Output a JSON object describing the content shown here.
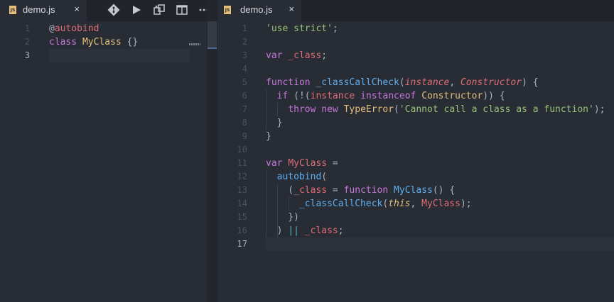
{
  "colors": {
    "background": "#282c34",
    "tab_bar": "#21252b",
    "keyword": "#c678dd",
    "class_name": "#e5c07b",
    "function_name": "#61afef",
    "string": "#98c379",
    "parameter": "#e06c75",
    "js_icon": "#e5c07b"
  },
  "left_editor": {
    "tab": {
      "title": "demo.js",
      "icon": "js-file-icon",
      "close": "×"
    },
    "toolbar": [
      {
        "name": "git-icon",
        "label": "Git"
      },
      {
        "name": "play-icon",
        "label": "Run"
      },
      {
        "name": "compare-icon",
        "label": "Compare"
      },
      {
        "name": "split-icon",
        "label": "Split editor"
      },
      {
        "name": "more-icon",
        "label": "More actions"
      }
    ],
    "line_numbers": [
      "1",
      "2",
      "3"
    ],
    "lines": [
      [
        {
          "t": "@",
          "c": "plain"
        },
        {
          "t": "autobind",
          "c": "var"
        }
      ],
      [
        {
          "t": "class",
          "c": "kw"
        },
        {
          "t": " ",
          "c": "plain"
        },
        {
          "t": "MyClass",
          "c": "cls"
        },
        {
          "t": " {}",
          "c": "plain"
        }
      ],
      []
    ]
  },
  "right_editor": {
    "tab": {
      "title": "demo.js",
      "icon": "js-file-icon",
      "close": "×"
    },
    "line_numbers": [
      "1",
      "2",
      "3",
      "4",
      "5",
      "6",
      "7",
      "8",
      "9",
      "10",
      "11",
      "12",
      "13",
      "14",
      "15",
      "16",
      "17"
    ],
    "lines": [
      [
        {
          "t": "'use strict'",
          "c": "str"
        },
        {
          "t": ";",
          "c": "plain"
        }
      ],
      [],
      [
        {
          "t": "var",
          "c": "kw"
        },
        {
          "t": " ",
          "c": "plain"
        },
        {
          "t": "_class",
          "c": "var"
        },
        {
          "t": ";",
          "c": "plain"
        }
      ],
      [],
      [
        {
          "t": "function",
          "c": "kw"
        },
        {
          "t": " ",
          "c": "plain"
        },
        {
          "t": "_classCallCheck",
          "c": "fn"
        },
        {
          "t": "(",
          "c": "plain"
        },
        {
          "t": "instance",
          "c": "par"
        },
        {
          "t": ", ",
          "c": "plain"
        },
        {
          "t": "Constructor",
          "c": "par"
        },
        {
          "t": ") {",
          "c": "plain"
        }
      ],
      [
        {
          "t": "  ",
          "c": "plain"
        },
        {
          "t": "if",
          "c": "kw"
        },
        {
          "t": " (!(",
          "c": "plain"
        },
        {
          "t": "instance",
          "c": "var"
        },
        {
          "t": " ",
          "c": "plain"
        },
        {
          "t": "instanceof",
          "c": "kw"
        },
        {
          "t": " ",
          "c": "plain"
        },
        {
          "t": "Constructor",
          "c": "cls"
        },
        {
          "t": ")) {",
          "c": "plain"
        }
      ],
      [
        {
          "t": "    ",
          "c": "plain"
        },
        {
          "t": "throw",
          "c": "kw"
        },
        {
          "t": " ",
          "c": "plain"
        },
        {
          "t": "new",
          "c": "kw"
        },
        {
          "t": " ",
          "c": "plain"
        },
        {
          "t": "TypeError",
          "c": "cls"
        },
        {
          "t": "(",
          "c": "plain"
        },
        {
          "t": "'Cannot call a class as a function'",
          "c": "str"
        },
        {
          "t": ");",
          "c": "plain"
        }
      ],
      [
        {
          "t": "  }",
          "c": "plain"
        }
      ],
      [
        {
          "t": "}",
          "c": "plain"
        }
      ],
      [],
      [
        {
          "t": "var",
          "c": "kw"
        },
        {
          "t": " ",
          "c": "plain"
        },
        {
          "t": "MyClass",
          "c": "var"
        },
        {
          "t": " =",
          "c": "plain"
        }
      ],
      [
        {
          "t": "  ",
          "c": "plain"
        },
        {
          "t": "autobind",
          "c": "fn"
        },
        {
          "t": "(",
          "c": "plain"
        }
      ],
      [
        {
          "t": "    (",
          "c": "plain"
        },
        {
          "t": "_class",
          "c": "var"
        },
        {
          "t": " = ",
          "c": "plain"
        },
        {
          "t": "function",
          "c": "kw"
        },
        {
          "t": " ",
          "c": "plain"
        },
        {
          "t": "MyClass",
          "c": "fn"
        },
        {
          "t": "() {",
          "c": "plain"
        }
      ],
      [
        {
          "t": "      ",
          "c": "plain"
        },
        {
          "t": "_classCallCheck",
          "c": "fn"
        },
        {
          "t": "(",
          "c": "plain"
        },
        {
          "t": "this",
          "c": "this"
        },
        {
          "t": ", ",
          "c": "plain"
        },
        {
          "t": "MyClass",
          "c": "var"
        },
        {
          "t": ");",
          "c": "plain"
        }
      ],
      [
        {
          "t": "    })",
          "c": "plain"
        }
      ],
      [
        {
          "t": "  ) ",
          "c": "plain"
        },
        {
          "t": "||",
          "c": "op"
        },
        {
          "t": " ",
          "c": "plain"
        },
        {
          "t": "_class",
          "c": "var"
        },
        {
          "t": ";",
          "c": "plain"
        }
      ],
      []
    ]
  }
}
